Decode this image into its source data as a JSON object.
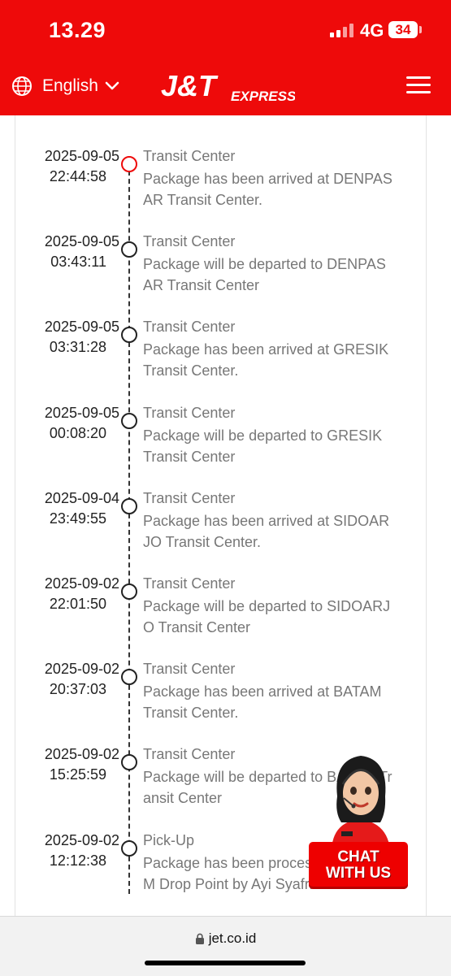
{
  "status_bar": {
    "time": "13.29",
    "network": "4G",
    "battery": "34"
  },
  "header": {
    "language": "English",
    "logo_text": "J&T",
    "logo_subtext": "EXPRESS",
    "brand_color": "#ee0a0a"
  },
  "tracking": {
    "events": [
      {
        "date": "2025-09-05",
        "time": "22:44:58",
        "title": "Transit Center",
        "description": "Package has been arrived at DENPAS\nAR Transit Center."
      },
      {
        "date": "2025-09-05",
        "time": "03:43:11",
        "title": "Transit Center",
        "description": "Package will be departed to DENPAS\nAR Transit Center"
      },
      {
        "date": "2025-09-05",
        "time": "03:31:28",
        "title": "Transit Center",
        "description": "Package has been arrived at GRESIK\nTransit Center."
      },
      {
        "date": "2025-09-05",
        "time": "00:08:20",
        "title": "Transit Center",
        "description": "Package will be departed to GRESIK\nTransit Center"
      },
      {
        "date": "2025-09-04",
        "time": "23:49:55",
        "title": "Transit Center",
        "description": "Package has been arrived at SIDOAR\nJO Transit Center."
      },
      {
        "date": "2025-09-02",
        "time": "22:01:50",
        "title": "Transit Center",
        "description": "Package will be departed to SIDOARJ\nO Transit Center"
      },
      {
        "date": "2025-09-02",
        "time": "20:37:03",
        "title": "Transit Center",
        "description": "Package has been arrived at BATAM\nTransit Center."
      },
      {
        "date": "2025-09-02",
        "time": "15:25:59",
        "title": "Transit Center",
        "description": "Package will be departed to BATAM Tr\nansit Center"
      },
      {
        "date": "2025-09-02",
        "time": "12:12:38",
        "title": "Pick-Up",
        "description": "Package has been processed at BATA\nM Drop Point by Ayi Syafrizal."
      }
    ]
  },
  "chat": {
    "line1": "CHAT",
    "line2": "WITH US"
  },
  "browser": {
    "url": "jet.co.id"
  }
}
